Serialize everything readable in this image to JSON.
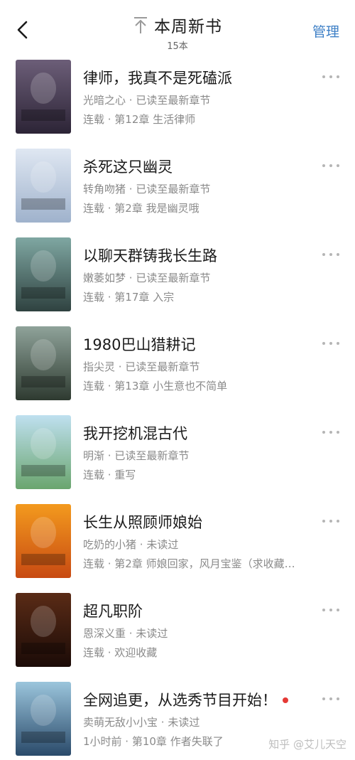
{
  "header": {
    "title": "本周新书",
    "count": "15本",
    "manage": "管理"
  },
  "books": [
    {
      "title": "律师，我真不是死磕派",
      "author": "光暗之心",
      "read_status": "已读至最新章节",
      "line2": "连载 · 第12章 生活律师",
      "cover_colors": [
        "#6c5e78",
        "#2c2436"
      ],
      "cover_text": "我真不是死磕派"
    },
    {
      "title": "杀死这只幽灵",
      "author": "转角吻猪",
      "read_status": "已读至最新章节",
      "line2": "连载 · 第2章 我是幽灵哦",
      "cover_colors": [
        "#dfe7f2",
        "#9fb2cc"
      ],
      "cover_text": "杀死这只幽灵"
    },
    {
      "title": "以聊天群铸我长生路",
      "author": "嫩萎如梦",
      "read_status": "已读至最新章节",
      "line2": "连载 · 第17章 入宗",
      "cover_colors": [
        "#7fa7a2",
        "#2f4240"
      ],
      "cover_text": "以聊天群铸我长生路"
    },
    {
      "title": "1980巴山猎耕记",
      "author": "指尖灵",
      "read_status": "已读至最新章节",
      "line2": "连载 · 第13章 小生意也不简单",
      "cover_colors": [
        "#8fa39a",
        "#2e3a30"
      ],
      "cover_text": "巴山猎耕记"
    },
    {
      "title": "我开挖机混古代",
      "author": "明渐",
      "read_status": "已读至最新章节",
      "line2": "连载 · 重写",
      "cover_colors": [
        "#bfe0f0",
        "#6aa56e"
      ],
      "cover_text": "我开挖机混古代"
    },
    {
      "title": "长生从照顾师娘始",
      "author": "吃奶的小猪",
      "read_status": "未读过",
      "line2": "连载 · 第2章 师娘回家，风月宝鉴（求收藏…",
      "cover_colors": [
        "#f39a1e",
        "#c84a12"
      ],
      "cover_text": "长生从照顾师娘始"
    },
    {
      "title": "超凡职阶",
      "author": "恩深义重",
      "read_status": "未读过",
      "line2": "连载 · 欢迎收藏",
      "cover_colors": [
        "#5a2b16",
        "#1b0b07"
      ],
      "cover_text": "超凡职阶"
    },
    {
      "title": "全网追更，从选秀节目开始！",
      "author": "卖萌无敌小小宝",
      "read_status": "未读过",
      "line2": "1小时前 · 第10章 作者失联了",
      "cover_colors": [
        "#9bc5dc",
        "#2a4a6a"
      ],
      "cover_text": "全网追更从选秀节目开始",
      "new_badge": true
    }
  ],
  "watermark": "知乎 @艾儿天空",
  "colors": {
    "accent": "#3d7fc6",
    "muted": "#8a8a8a",
    "badge": "#e53935"
  }
}
